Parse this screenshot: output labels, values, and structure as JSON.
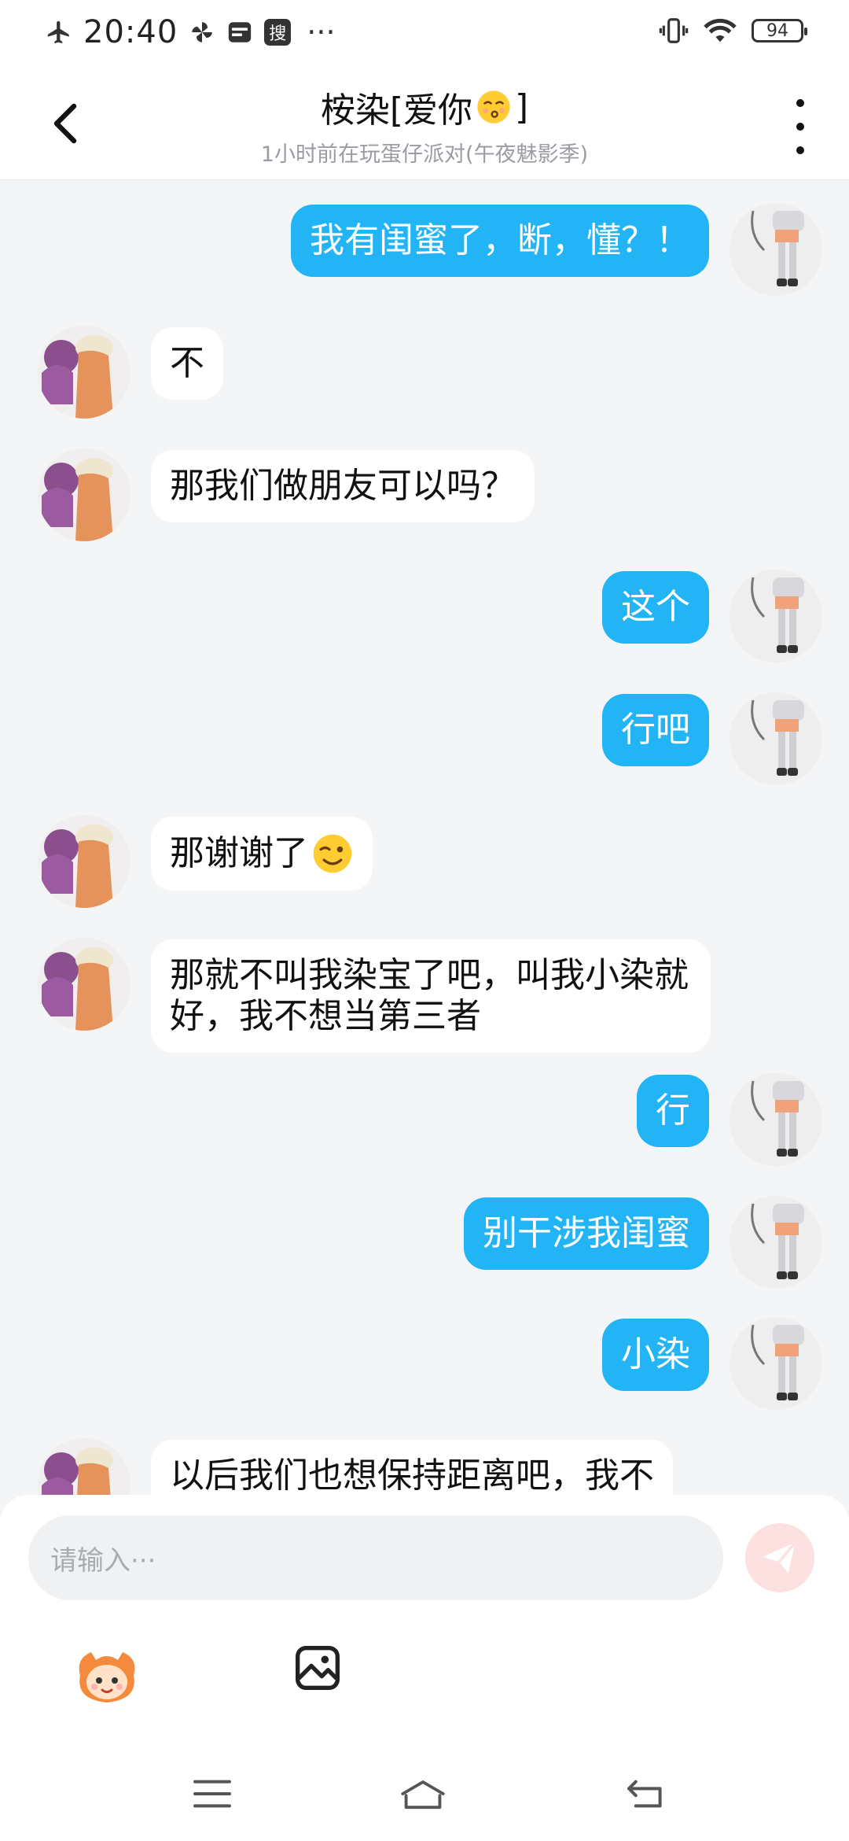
{
  "status_bar": {
    "time": "20:40",
    "search_badge": "搜",
    "more_indicator": "···",
    "battery": "94",
    "icons": [
      "airplane-icon",
      "pinwheel-icon",
      "card-icon",
      "search-badge-icon",
      "vibrate-icon",
      "wifi-icon",
      "battery-icon"
    ]
  },
  "header": {
    "title": "桉染[爱你",
    "title_suffix": "]",
    "subtitle": "1小时前在玩蛋仔派对(午夜魅影季)",
    "back_icon": "chevron-left-icon",
    "more_icon": "more-vertical-icon"
  },
  "messages": [
    {
      "side": "out",
      "text": "我有闺蜜了，断，懂？！"
    },
    {
      "side": "in",
      "text": "不"
    },
    {
      "side": "in",
      "text": "那我们做朋友可以吗？"
    },
    {
      "side": "out",
      "text": "这个"
    },
    {
      "side": "out",
      "text": "行吧"
    },
    {
      "side": "in",
      "text": "那谢谢了"
    },
    {
      "side": "in",
      "text": "那就不叫我染宝了吧，叫我小染就好，我不想当第三者"
    },
    {
      "side": "out",
      "text": "行"
    },
    {
      "side": "out",
      "text": "别干涉我闺蜜"
    },
    {
      "side": "out",
      "text": "小染"
    },
    {
      "side": "in",
      "text": "以后我们也想保持距离吧，我不"
    }
  ],
  "composer": {
    "placeholder": "请输入···",
    "send_icon": "send-icon",
    "tools": [
      "mascot-sticker-icon",
      "image-icon"
    ]
  },
  "nav_bar": {
    "icons": [
      "menu-icon",
      "home-icon",
      "back-icon"
    ]
  },
  "colors": {
    "outgoing_bubble": "#23b4f6",
    "incoming_bubble": "#ffffff",
    "chat_background": "#f4f5f7",
    "send_button": "#fde1e1"
  }
}
